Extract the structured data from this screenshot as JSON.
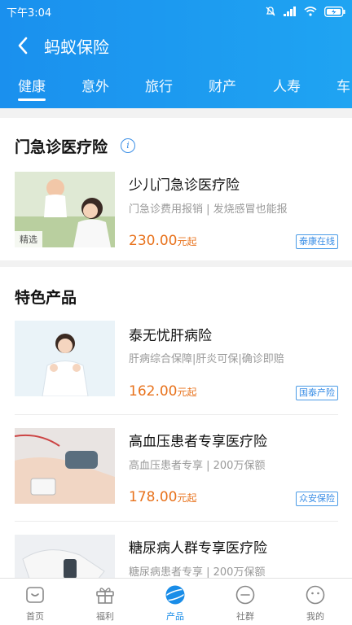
{
  "status_bar": {
    "time": "下午3:04",
    "battery_icon": "battery-charging-icon"
  },
  "header": {
    "title": "蚂蚁保险",
    "back_icon": "back-arrow-icon"
  },
  "tabs": [
    {
      "label": "健康",
      "active": true
    },
    {
      "label": "意外",
      "active": false
    },
    {
      "label": "旅行",
      "active": false
    },
    {
      "label": "财产",
      "active": false
    },
    {
      "label": "人寿",
      "active": false
    },
    {
      "label": "车",
      "active": false
    }
  ],
  "section_emergency": {
    "title": "门急诊医疗险",
    "info_icon": "i",
    "products": [
      {
        "name": "少儿门急诊医疗险",
        "desc": "门急诊费用报销 | 发烧感冒也能报",
        "price": "230.00",
        "price_unit": "元起",
        "badge": "泰康在线",
        "image_tag": "精选"
      }
    ]
  },
  "section_special": {
    "title": "特色产品",
    "products": [
      {
        "name": "泰无忧肝病险",
        "desc": "肝病综合保障|肝炎可保|确诊即赔",
        "price": "162.00",
        "price_unit": "元起",
        "badge": "国泰产险"
      },
      {
        "name": "高血压患者专享医疗险",
        "desc": "高血压患者专享 | 200万保额",
        "price": "178.00",
        "price_unit": "元起",
        "badge": "众安保险"
      },
      {
        "name": "糖尿病人群专享医疗险",
        "desc": "糖尿病患者专享 | 200万保额"
      }
    ]
  },
  "bottom_nav": [
    {
      "label": "首页",
      "icon": "home-icon",
      "active": false
    },
    {
      "label": "福利",
      "icon": "gift-icon",
      "active": false
    },
    {
      "label": "产品",
      "icon": "planet-icon",
      "active": true
    },
    {
      "label": "社群",
      "icon": "chat-icon",
      "active": false
    },
    {
      "label": "我的",
      "icon": "profile-icon",
      "active": false
    }
  ],
  "colors": {
    "header_blue": "#1a90ee",
    "price_orange": "#e8721c",
    "badge_blue": "#3a8ee6",
    "active_nav": "#1a8de8"
  }
}
